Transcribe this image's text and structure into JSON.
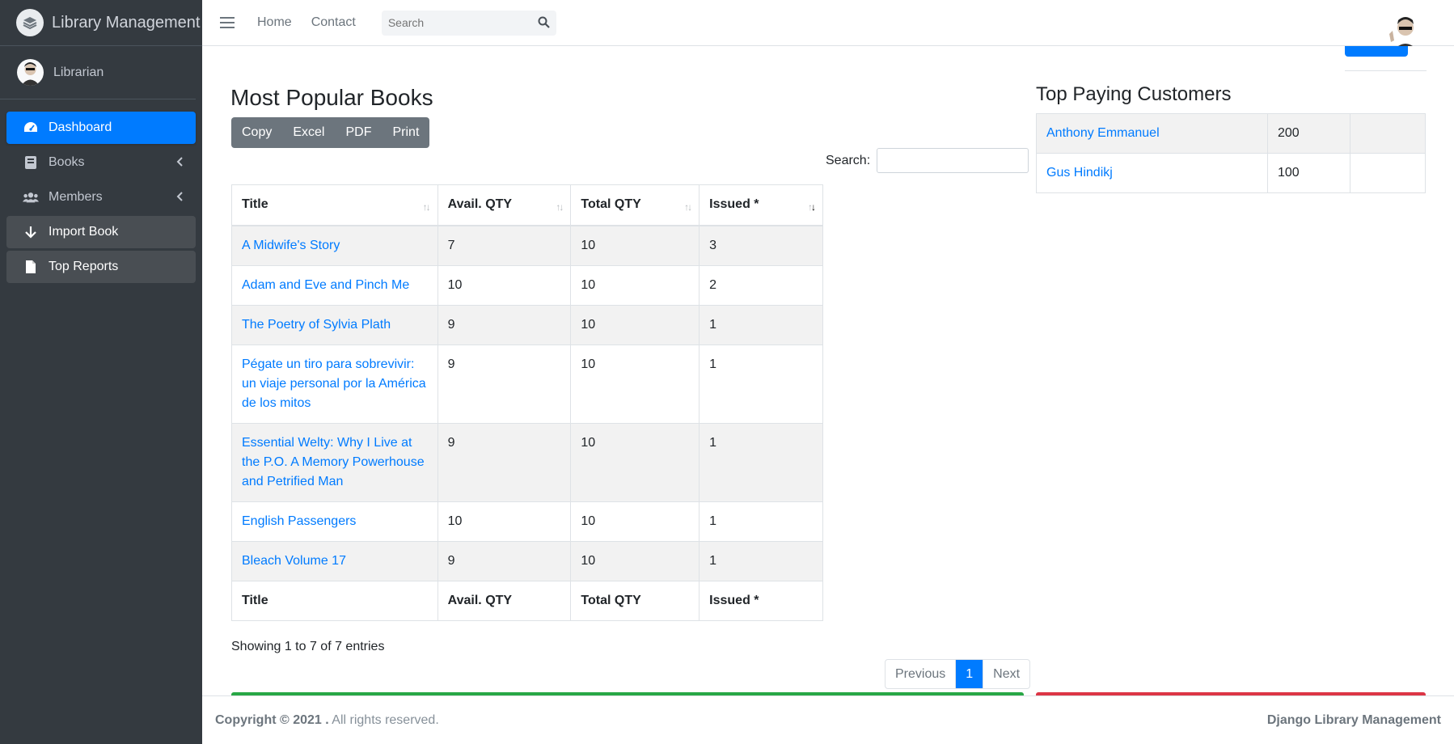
{
  "brand": {
    "title": "Library Management"
  },
  "user": {
    "name": "Librarian"
  },
  "sidebar": {
    "items": [
      {
        "label": "Dashboard",
        "icon": "tachometer-icon"
      },
      {
        "label": "Books",
        "icon": "book-icon"
      },
      {
        "label": "Members",
        "icon": "users-icon"
      },
      {
        "label": "Import Book",
        "icon": "arrow-down-icon"
      },
      {
        "label": "Top Reports",
        "icon": "file-icon"
      }
    ]
  },
  "topbar": {
    "links": [
      "Home",
      "Contact"
    ],
    "search_placeholder": "Search"
  },
  "popular": {
    "title": "Most Popular Books",
    "buttons": [
      "Copy",
      "Excel",
      "PDF",
      "Print"
    ],
    "search_label": "Search:",
    "columns": [
      "Title",
      "Avail. QTY",
      "Total QTY",
      "Issued *"
    ],
    "rows": [
      {
        "title": "A Midwife's Story",
        "avail": "7",
        "total": "10",
        "issued": "3"
      },
      {
        "title": "Adam and Eve and Pinch Me",
        "avail": "10",
        "total": "10",
        "issued": "2"
      },
      {
        "title": "The Poetry of Sylvia Plath",
        "avail": "9",
        "total": "10",
        "issued": "1"
      },
      {
        "title": "Pégate un tiro para sobrevivir: un viaje personal por la América de los mitos",
        "avail": "9",
        "total": "10",
        "issued": "1"
      },
      {
        "title": "Essential Welty: Why I Live at the P.O. A Memory Powerhouse and Petrified Man",
        "avail": "9",
        "total": "10",
        "issued": "1"
      },
      {
        "title": "English Passengers",
        "avail": "10",
        "total": "10",
        "issued": "1"
      },
      {
        "title": "Bleach Volume 17",
        "avail": "9",
        "total": "10",
        "issued": "1"
      }
    ],
    "info": "Showing 1 to 7 of 7 entries",
    "pager": {
      "prev": "Previous",
      "current": "1",
      "next": "Next"
    }
  },
  "customers": {
    "title": "Top Paying Customers",
    "rows": [
      {
        "name": "Anthony Emmanuel",
        "amount": "200",
        "extra": ""
      },
      {
        "name": "Gus Hindikj",
        "amount": "100",
        "extra": ""
      }
    ]
  },
  "footer": {
    "copyright_bold": "Copyright © 2021 .",
    "copyright_rest": " All rights reserved.",
    "right": "Django Library Management"
  },
  "colors": {
    "sidebar": "#343a40",
    "primary": "#007bff",
    "success": "#28a745",
    "danger": "#dc3545"
  }
}
